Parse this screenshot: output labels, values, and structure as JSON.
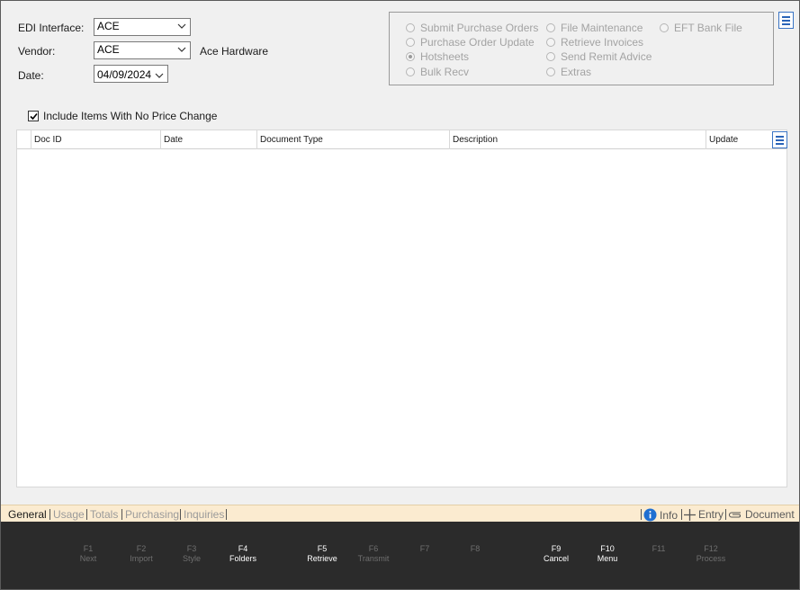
{
  "form": {
    "edi_interface_label": "EDI Interface:",
    "edi_interface_value": "ACE",
    "vendor_label": "Vendor:",
    "vendor_value": "ACE",
    "vendor_name": "Ace Hardware",
    "date_label": "Date:",
    "date_value": "04/09/2024"
  },
  "options": {
    "submit_po": "Submit Purchase Orders",
    "po_update": "Purchase Order Update",
    "hotsheets": "Hotsheets",
    "bulk_recv": "Bulk Recv",
    "file_maint": "File Maintenance",
    "retrieve_inv": "Retrieve Invoices",
    "send_remit": "Send Remit Advice",
    "extras": "Extras",
    "eft_bank": "EFT Bank File",
    "selected": "Hotsheets"
  },
  "include_label": "Include Items With No Price Change",
  "include_checked": true,
  "grid": {
    "columns": [
      "Doc ID",
      "Date",
      "Document Type",
      "Description",
      "Update"
    ],
    "rows": []
  },
  "tabs": [
    "General",
    "Usage",
    "Totals",
    "Purchasing",
    "Inquiries"
  ],
  "active_tab": "General",
  "tools": {
    "info": "Info",
    "entry": "Entry",
    "document": "Document"
  },
  "fkeys": [
    {
      "key": "F1",
      "label": "Next",
      "enabled": false
    },
    {
      "key": "F2",
      "label": "Import",
      "enabled": false
    },
    {
      "key": "F3",
      "label": "Style",
      "enabled": false
    },
    {
      "key": "F4",
      "label": "Folders",
      "enabled": true
    },
    {
      "key": "F5",
      "label": "Retrieve",
      "enabled": true
    },
    {
      "key": "F6",
      "label": "Transmit",
      "enabled": false
    },
    {
      "key": "F7",
      "label": "",
      "enabled": false
    },
    {
      "key": "F8",
      "label": "",
      "enabled": false
    },
    {
      "key": "F9",
      "label": "Cancel",
      "enabled": true
    },
    {
      "key": "F10",
      "label": "Menu",
      "enabled": true
    },
    {
      "key": "F11",
      "label": "",
      "enabled": false
    },
    {
      "key": "F12",
      "label": "Process",
      "enabled": false
    }
  ],
  "colors": {
    "accent": "#2a64b8",
    "tab_bar": "#fbebd0",
    "fkey_bg": "#2b2b2b",
    "disabled_text": "#a3a3a3"
  }
}
